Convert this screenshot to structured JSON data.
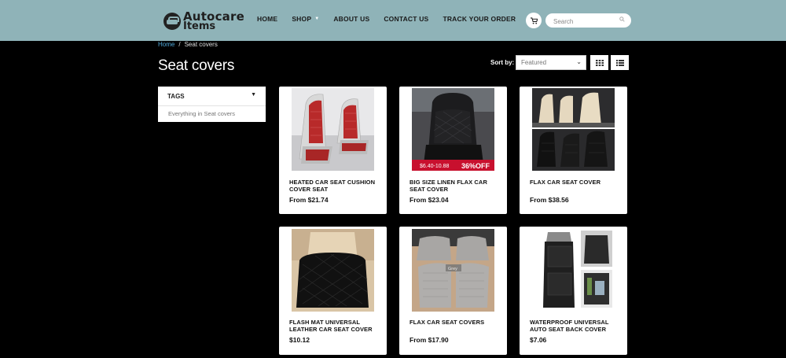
{
  "header": {
    "logo_line1": "Autocare",
    "logo_line2": "Items",
    "nav": [
      "HOME",
      "SHOP",
      "ABOUT US",
      "CONTACT US",
      "TRACK YOUR ORDER"
    ],
    "search_placeholder": "Search"
  },
  "breadcrumb": {
    "home": "Home",
    "sep": "/",
    "current": "Seat covers"
  },
  "page_title": "Seat covers",
  "sort": {
    "label": "Sort by:",
    "selected": "Featured"
  },
  "sidebar": {
    "tags_title": "TAGS",
    "tags_item": "Everything in Seat covers"
  },
  "products": [
    {
      "title": "HEATED CAR SEAT CUSHION COVER SEAT",
      "price": "From $21.74"
    },
    {
      "title": "BIG SIZE LINEN FLAX CAR SEAT COVER",
      "price": "From $23.04",
      "badge_price": "$6.40-10.88",
      "badge_discount": "36%OFF"
    },
    {
      "title": "FLAX CAR SEAT COVER",
      "price": "From $38.56"
    },
    {
      "title": "FLASH MAT UNIVERSAL LEATHER CAR SEAT COVER",
      "price": "$10.12"
    },
    {
      "title": "FLAX CAR SEAT COVERS",
      "price": "From $17.90",
      "img_tag": "Grey"
    },
    {
      "title": "WATERPROOF UNIVERSAL AUTO SEAT BACK COVER",
      "price": "$7.06"
    }
  ],
  "colors": {
    "header_bg": "#8fb3b8",
    "page_bg": "#000000",
    "link": "#4ea6d6"
  },
  "icons": [
    "car-logo-icon",
    "cart-icon",
    "search-icon",
    "grid-view-icon",
    "list-view-icon",
    "caret-down-icon"
  ]
}
